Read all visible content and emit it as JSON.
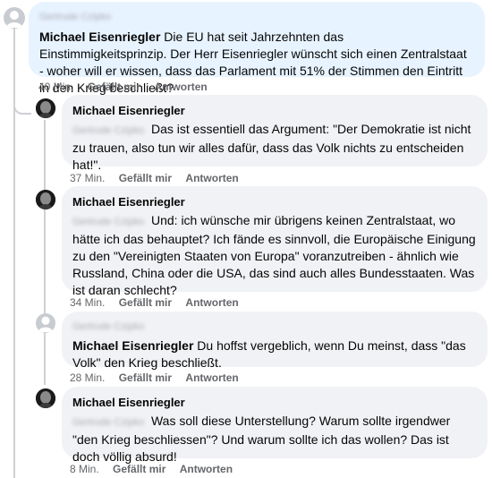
{
  "comments": [
    {
      "mention": "Gertrude Czipko",
      "author": "Michael Eisenriegler",
      "text": "Die EU hat seit Jahrzehnten das Einstimmigkeitsprinzip. Der Herr Eisenriegler wünscht sich einen Zentralstaat - woher will er wissen, dass das Parlament mit 51% der Stimmen den Eintritt in den Krieg beschließt?",
      "time": "40 Min.",
      "like": "Gefällt mir",
      "reply": "Antworten"
    },
    {
      "author": "Michael Eisenriegler",
      "mention": "Gertrude Czipko",
      "text": "Das ist essentiell das Argument: \"Der Demokratie ist nicht zu trauen, also tun wir alles dafür, dass das Volk nichts zu entscheiden hat!\".",
      "time": "37 Min.",
      "like": "Gefällt mir",
      "reply": "Antworten"
    },
    {
      "author": "Michael Eisenriegler",
      "mention": "Gertrude Czipko",
      "text": "Und: ich wünsche mir übrigens keinen Zentralstaat, wo hätte ich das behauptet? Ich fände es sinnvoll, die Europäische Einigung zu den \"Vereinigten Staaten von Europa\" voranzutreiben - ähnlich wie Russland, China oder die USA, das sind auch alles Bundesstaaten. Was ist daran schlecht?",
      "time": "34 Min.",
      "like": "Gefällt mir",
      "reply": "Antworten"
    },
    {
      "mention": "Gertrude Czipko",
      "author": "Michael Eisenriegler",
      "text": "Du hoffst vergeblich, wenn Du meinst, dass \"das Volk\" den Krieg beschließt.",
      "time": "28 Min.",
      "like": "Gefällt mir",
      "reply": "Antworten"
    },
    {
      "author": "Michael Eisenriegler",
      "mention": "Gertrude Czipko",
      "text": "Was soll diese Unterstellung? Warum sollte irgendwer \"den Krieg beschliessen\"? Und warum sollte ich das wollen? Das ist doch völlig absurd!",
      "time": "8 Min.",
      "like": "Gefällt mir",
      "reply": "Antworten"
    }
  ]
}
